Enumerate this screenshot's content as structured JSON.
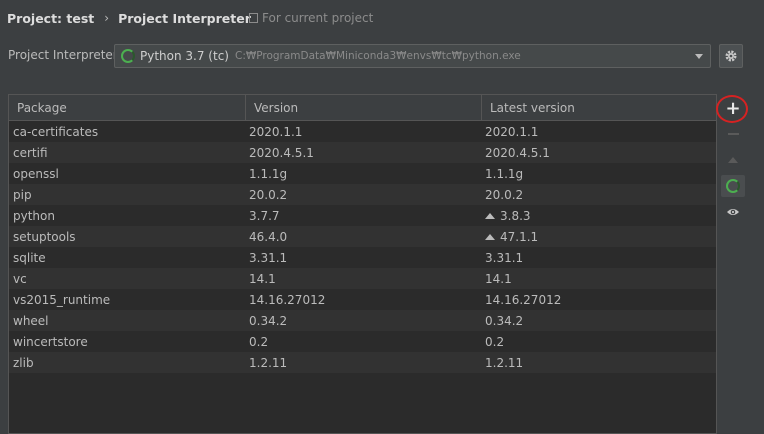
{
  "breadcrumb": {
    "parent": "Project: test",
    "current": "Project Interpreter"
  },
  "scope_note": "For current project",
  "interpreter": {
    "label": "Project Interpreter:",
    "name": "Python 3.7 (tc)",
    "path": "C:₩ProgramData₩Miniconda3₩envs₩tc₩python.exe"
  },
  "table": {
    "headers": [
      "Package",
      "Version",
      "Latest version"
    ],
    "rows": [
      {
        "package": "ca-certificates",
        "version": "2020.1.1",
        "latest": "2020.1.1",
        "upgrade": false
      },
      {
        "package": "certifi",
        "version": "2020.4.5.1",
        "latest": "2020.4.5.1",
        "upgrade": false
      },
      {
        "package": "openssl",
        "version": "1.1.1g",
        "latest": "1.1.1g",
        "upgrade": false
      },
      {
        "package": "pip",
        "version": "20.0.2",
        "latest": "20.0.2",
        "upgrade": false
      },
      {
        "package": "python",
        "version": "3.7.7",
        "latest": "3.8.3",
        "upgrade": true
      },
      {
        "package": "setuptools",
        "version": "46.4.0",
        "latest": "47.1.1",
        "upgrade": true
      },
      {
        "package": "sqlite",
        "version": "3.31.1",
        "latest": "3.31.1",
        "upgrade": false
      },
      {
        "package": "vc",
        "version": "14.1",
        "latest": "14.1",
        "upgrade": false
      },
      {
        "package": "vs2015_runtime",
        "version": "14.16.27012",
        "latest": "14.16.27012",
        "upgrade": false
      },
      {
        "package": "wheel",
        "version": "0.34.2",
        "latest": "0.34.2",
        "upgrade": false
      },
      {
        "package": "wincertstore",
        "version": "0.2",
        "latest": "0.2",
        "upgrade": false
      },
      {
        "package": "zlib",
        "version": "1.2.11",
        "latest": "1.2.11",
        "upgrade": false
      }
    ]
  },
  "toolbar": {
    "add_glyph": "+",
    "icons": [
      "plus-icon",
      "minus-icon",
      "upgrade-icon",
      "refresh-icon",
      "eye-icon"
    ]
  },
  "colors": {
    "accent_green": "#4caf50",
    "annotation_red": "#d62222",
    "background": "#3c3f41",
    "table_bg": "#2b2b2b"
  }
}
